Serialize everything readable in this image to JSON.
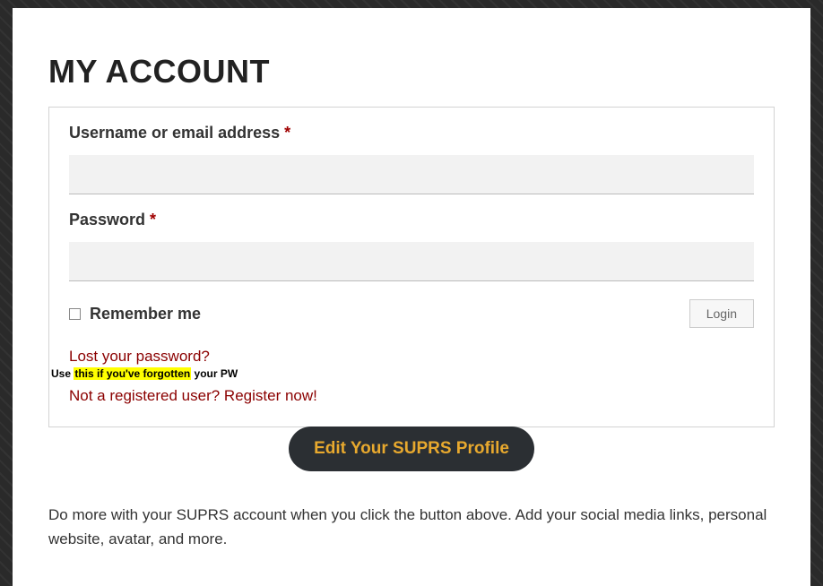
{
  "page": {
    "title": "MY ACCOUNT"
  },
  "form": {
    "username": {
      "label": "Username or email address ",
      "required": "*",
      "value": ""
    },
    "password": {
      "label": "Password ",
      "required": "*",
      "value": ""
    },
    "remember": {
      "label": "Remember me",
      "checked": false
    },
    "login_button": "Login",
    "lost_password": "Lost your password?",
    "highlight_note": {
      "part1": "Use ",
      "highlighted": "this if you've forgotten",
      "part2": " your PW"
    },
    "register_link": "Not a registered user? Register now!"
  },
  "edit_profile_button": "Edit Your SUPRS Profile",
  "description": "Do more with your SUPRS account when you click the button above. Add your social media links, personal website, avatar, and more."
}
